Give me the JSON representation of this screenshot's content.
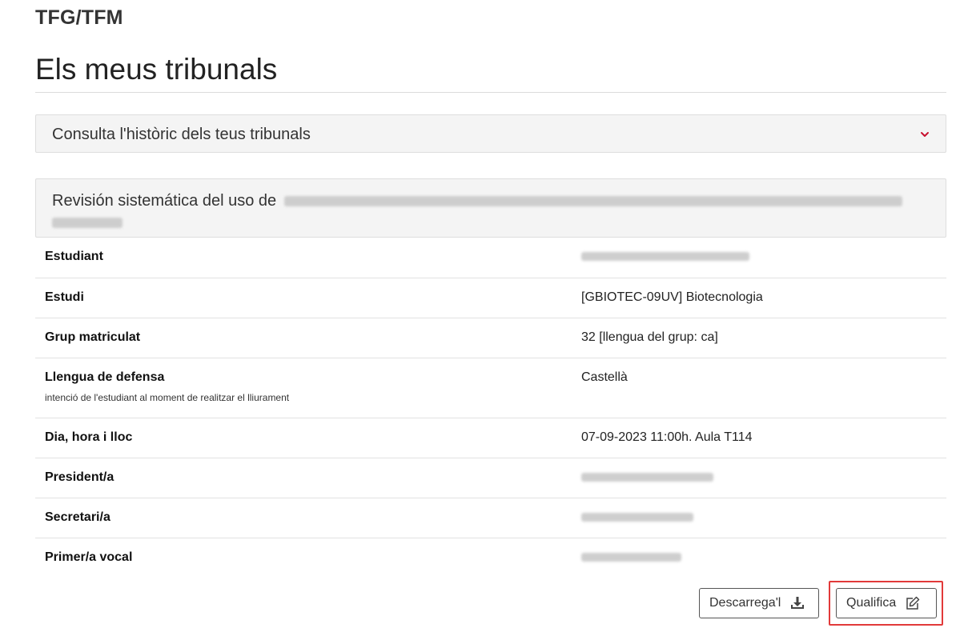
{
  "app": {
    "title": "TFG/TFM"
  },
  "page": {
    "title": "Els meus tribunals"
  },
  "history": {
    "label": "Consulta l'històric dels teus tribunals",
    "chevron_color": "#c8102e"
  },
  "tfg": {
    "title_visible": "Revisión sistemática del uso de"
  },
  "details": {
    "rows": [
      {
        "label": "Estudiant",
        "value": ""
      },
      {
        "label": "Estudi",
        "value": "[GBIOTEC-09UV] Biotecnologia"
      },
      {
        "label": "Grup matriculat",
        "value": "32 [llengua del grup: ca]"
      },
      {
        "label": "Llengua de defensa",
        "sublabel": "intenció de l'estudiant al moment de realitzar el lliurament",
        "value": "Castellà"
      },
      {
        "label": "Dia, hora i lloc",
        "value": "07-09-2023 11:00h. Aula T114"
      },
      {
        "label": "President/a",
        "value": ""
      },
      {
        "label": "Secretari/a",
        "value": ""
      },
      {
        "label": "Primer/a vocal",
        "value": ""
      }
    ]
  },
  "actions": {
    "download_label": "Descarrega'l",
    "grade_label": "Qualifica",
    "highlight_color": "#e23a3a"
  }
}
